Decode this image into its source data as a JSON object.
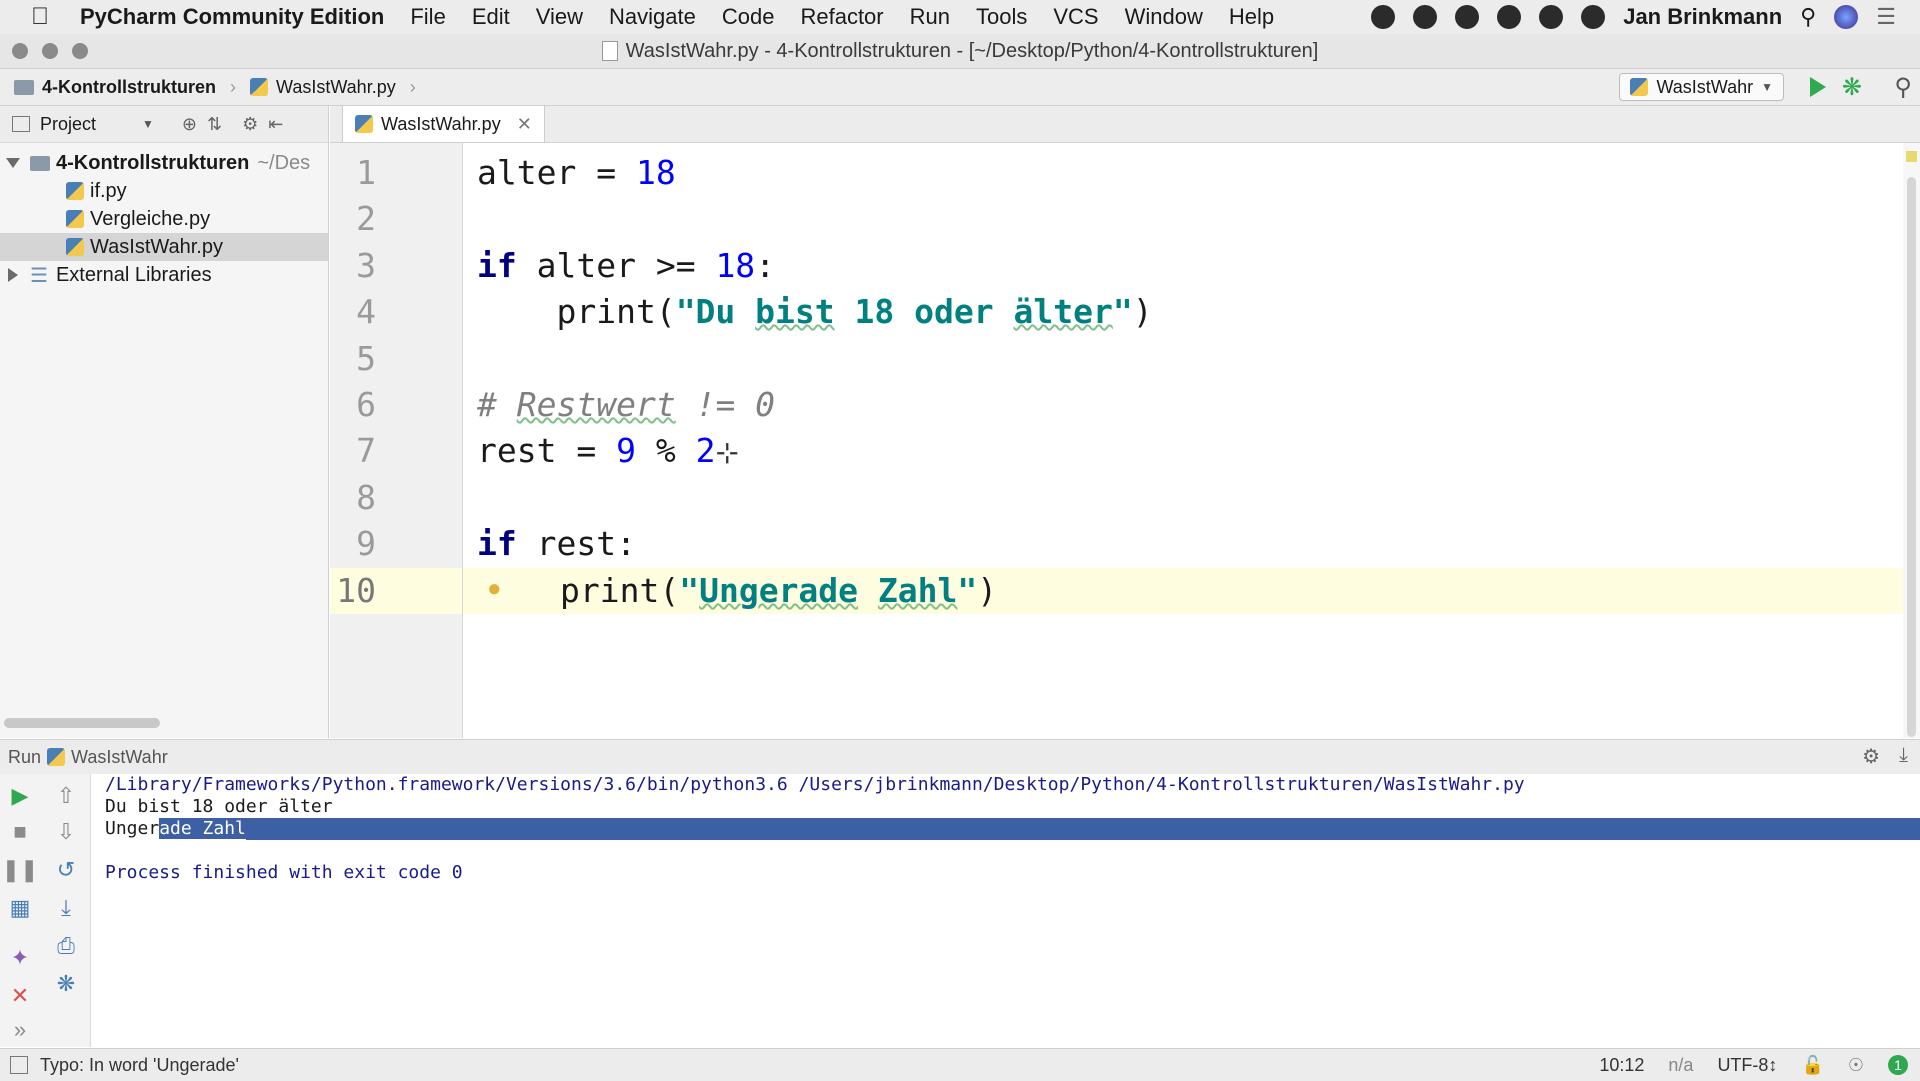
{
  "menubar": {
    "app_name": "PyCharm Community Edition",
    "items": [
      "File",
      "Edit",
      "View",
      "Navigate",
      "Code",
      "Refactor",
      "Run",
      "Tools",
      "VCS",
      "Window",
      "Help"
    ],
    "user": "Jan Brinkmann"
  },
  "window": {
    "title": "WasIstWahr.py - 4-Kontrollstrukturen - [~/Desktop/Python/4-Kontrollstrukturen]"
  },
  "navbar": {
    "breadcrumbs": [
      "4-Kontrollstrukturen",
      "WasIstWahr.py"
    ],
    "run_config": "WasIstWahr"
  },
  "project_panel": {
    "title": "Project",
    "root": {
      "name": "4-Kontrollstrukturen",
      "path": "~/Des"
    },
    "files": [
      "if.py",
      "Vergleiche.py",
      "WasIstWahr.py"
    ],
    "selected_file": "WasIstWahr.py",
    "external": "External Libraries"
  },
  "editor": {
    "tab": "WasIstWahr.py",
    "line_numbers": [
      "1",
      "2",
      "3",
      "4",
      "5",
      "6",
      "7",
      "8",
      "9",
      "10"
    ],
    "code": {
      "l1_var": "alter",
      "l1_op": " = ",
      "l1_num": "18",
      "l3_kw": "if",
      "l3_rest": " alter >= ",
      "l3_num": "18",
      "l3_colon": ":",
      "l4_print": "    print(",
      "l4_str_a": "\"Du ",
      "l4_str_bist": "bist",
      "l4_str_b": " 18 oder ",
      "l4_str_alter": "älter",
      "l4_str_c": "\"",
      "l4_close": ")",
      "l6_hash": "# ",
      "l6_word": "Restwert",
      "l6_rest": " != 0",
      "l7_a": "rest = ",
      "l7_num9": "9",
      "l7_op": " % ",
      "l7_num2": "2",
      "l9_kw": "if",
      "l9_rest": " rest:",
      "l10_print": "print(",
      "l10_q1": "\"",
      "l10_word1": "Ungerade",
      "l10_sp": " ",
      "l10_word2": "Zahl",
      "l10_q2": "\"",
      "l10_close": ")"
    },
    "current_line": "10"
  },
  "run_panel": {
    "label": "Run",
    "config": "WasIstWahr",
    "console": {
      "command": "/Library/Frameworks/Python.framework/Versions/3.6/bin/python3.6 /Users/jbrinkmann/Desktop/Python/4-Kontrollstrukturen/WasIstWahr.py",
      "output1": "Du bist 18 oder älter",
      "output2_unselected": "Unger",
      "output2_selected": "ade Zahl",
      "exit": "Process finished with exit code 0"
    }
  },
  "statusbar": {
    "message": "Typo: In word 'Ungerade'",
    "position": "10:12",
    "na": "n/a",
    "encoding": "UTF-8↕",
    "badge": "1"
  },
  "colors": {
    "keyword": "#000080",
    "number": "#0000ff",
    "string": "#008080",
    "comment": "#808080",
    "console_selection": "#3d5fa3",
    "caret_line": "#fffde0"
  }
}
